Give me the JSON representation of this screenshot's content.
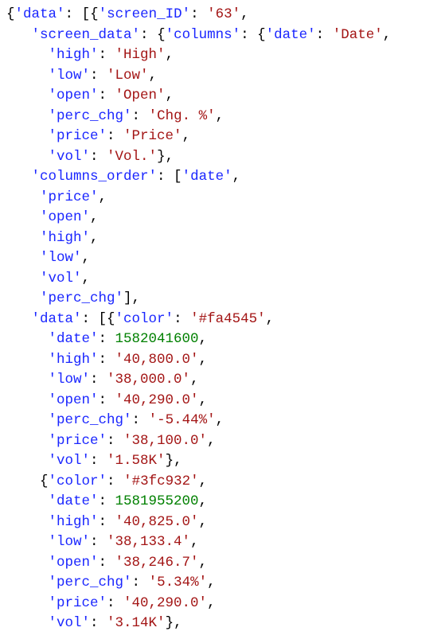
{
  "code": {
    "root_open": "{'data': [{'screen_ID': '63',",
    "screen_data_open": "   'screen_data': {'columns': {'date': 'Date',",
    "columns": [
      {
        "k": "'high'",
        "v": "'High'",
        "c": ","
      },
      {
        "k": "'low'",
        "v": "'Low'",
        "c": ","
      },
      {
        "k": "'open'",
        "v": "'Open'",
        "c": ","
      },
      {
        "k": "'perc_chg'",
        "v": "'Chg. %'",
        "c": ","
      },
      {
        "k": "'price'",
        "v": "'Price'",
        "c": ","
      },
      {
        "k": "'vol'",
        "v": "'Vol.'",
        "c": "},"
      }
    ],
    "columns_order_open": "   'columns_order': ['date',",
    "columns_order": [
      {
        "v": "'price'",
        "c": ","
      },
      {
        "v": "'open'",
        "c": ","
      },
      {
        "v": "'high'",
        "c": ","
      },
      {
        "v": "'low'",
        "c": ","
      },
      {
        "v": "'vol'",
        "c": ","
      },
      {
        "v": "'perc_chg'",
        "c": "],"
      }
    ],
    "data_open": "   'data': [{'color': '#fa4545',",
    "row1": [
      {
        "k": "'date'",
        "n": "1582041600",
        "c": ","
      },
      {
        "k": "'high'",
        "v": "'40,800.0'",
        "c": ","
      },
      {
        "k": "'low'",
        "v": "'38,000.0'",
        "c": ","
      },
      {
        "k": "'open'",
        "v": "'40,290.0'",
        "c": ","
      },
      {
        "k": "'perc_chg'",
        "v": "'-5.44%'",
        "c": ","
      },
      {
        "k": "'price'",
        "v": "'38,100.0'",
        "c": ","
      },
      {
        "k": "'vol'",
        "v": "'1.58K'",
        "c": "},"
      }
    ],
    "row2_open": "    {'color': '#3fc932',",
    "row2": [
      {
        "k": "'date'",
        "n": "1581955200",
        "c": ","
      },
      {
        "k": "'high'",
        "v": "'40,825.0'",
        "c": ","
      },
      {
        "k": "'low'",
        "v": "'38,133.4'",
        "c": ","
      },
      {
        "k": "'open'",
        "v": "'38,246.7'",
        "c": ","
      },
      {
        "k": "'perc_chg'",
        "v": "'5.34%'",
        "c": ","
      },
      {
        "k": "'price'",
        "v": "'40,290.0'",
        "c": ","
      },
      {
        "k": "'vol'",
        "v": "'3.14K'",
        "c": "},"
      }
    ]
  }
}
